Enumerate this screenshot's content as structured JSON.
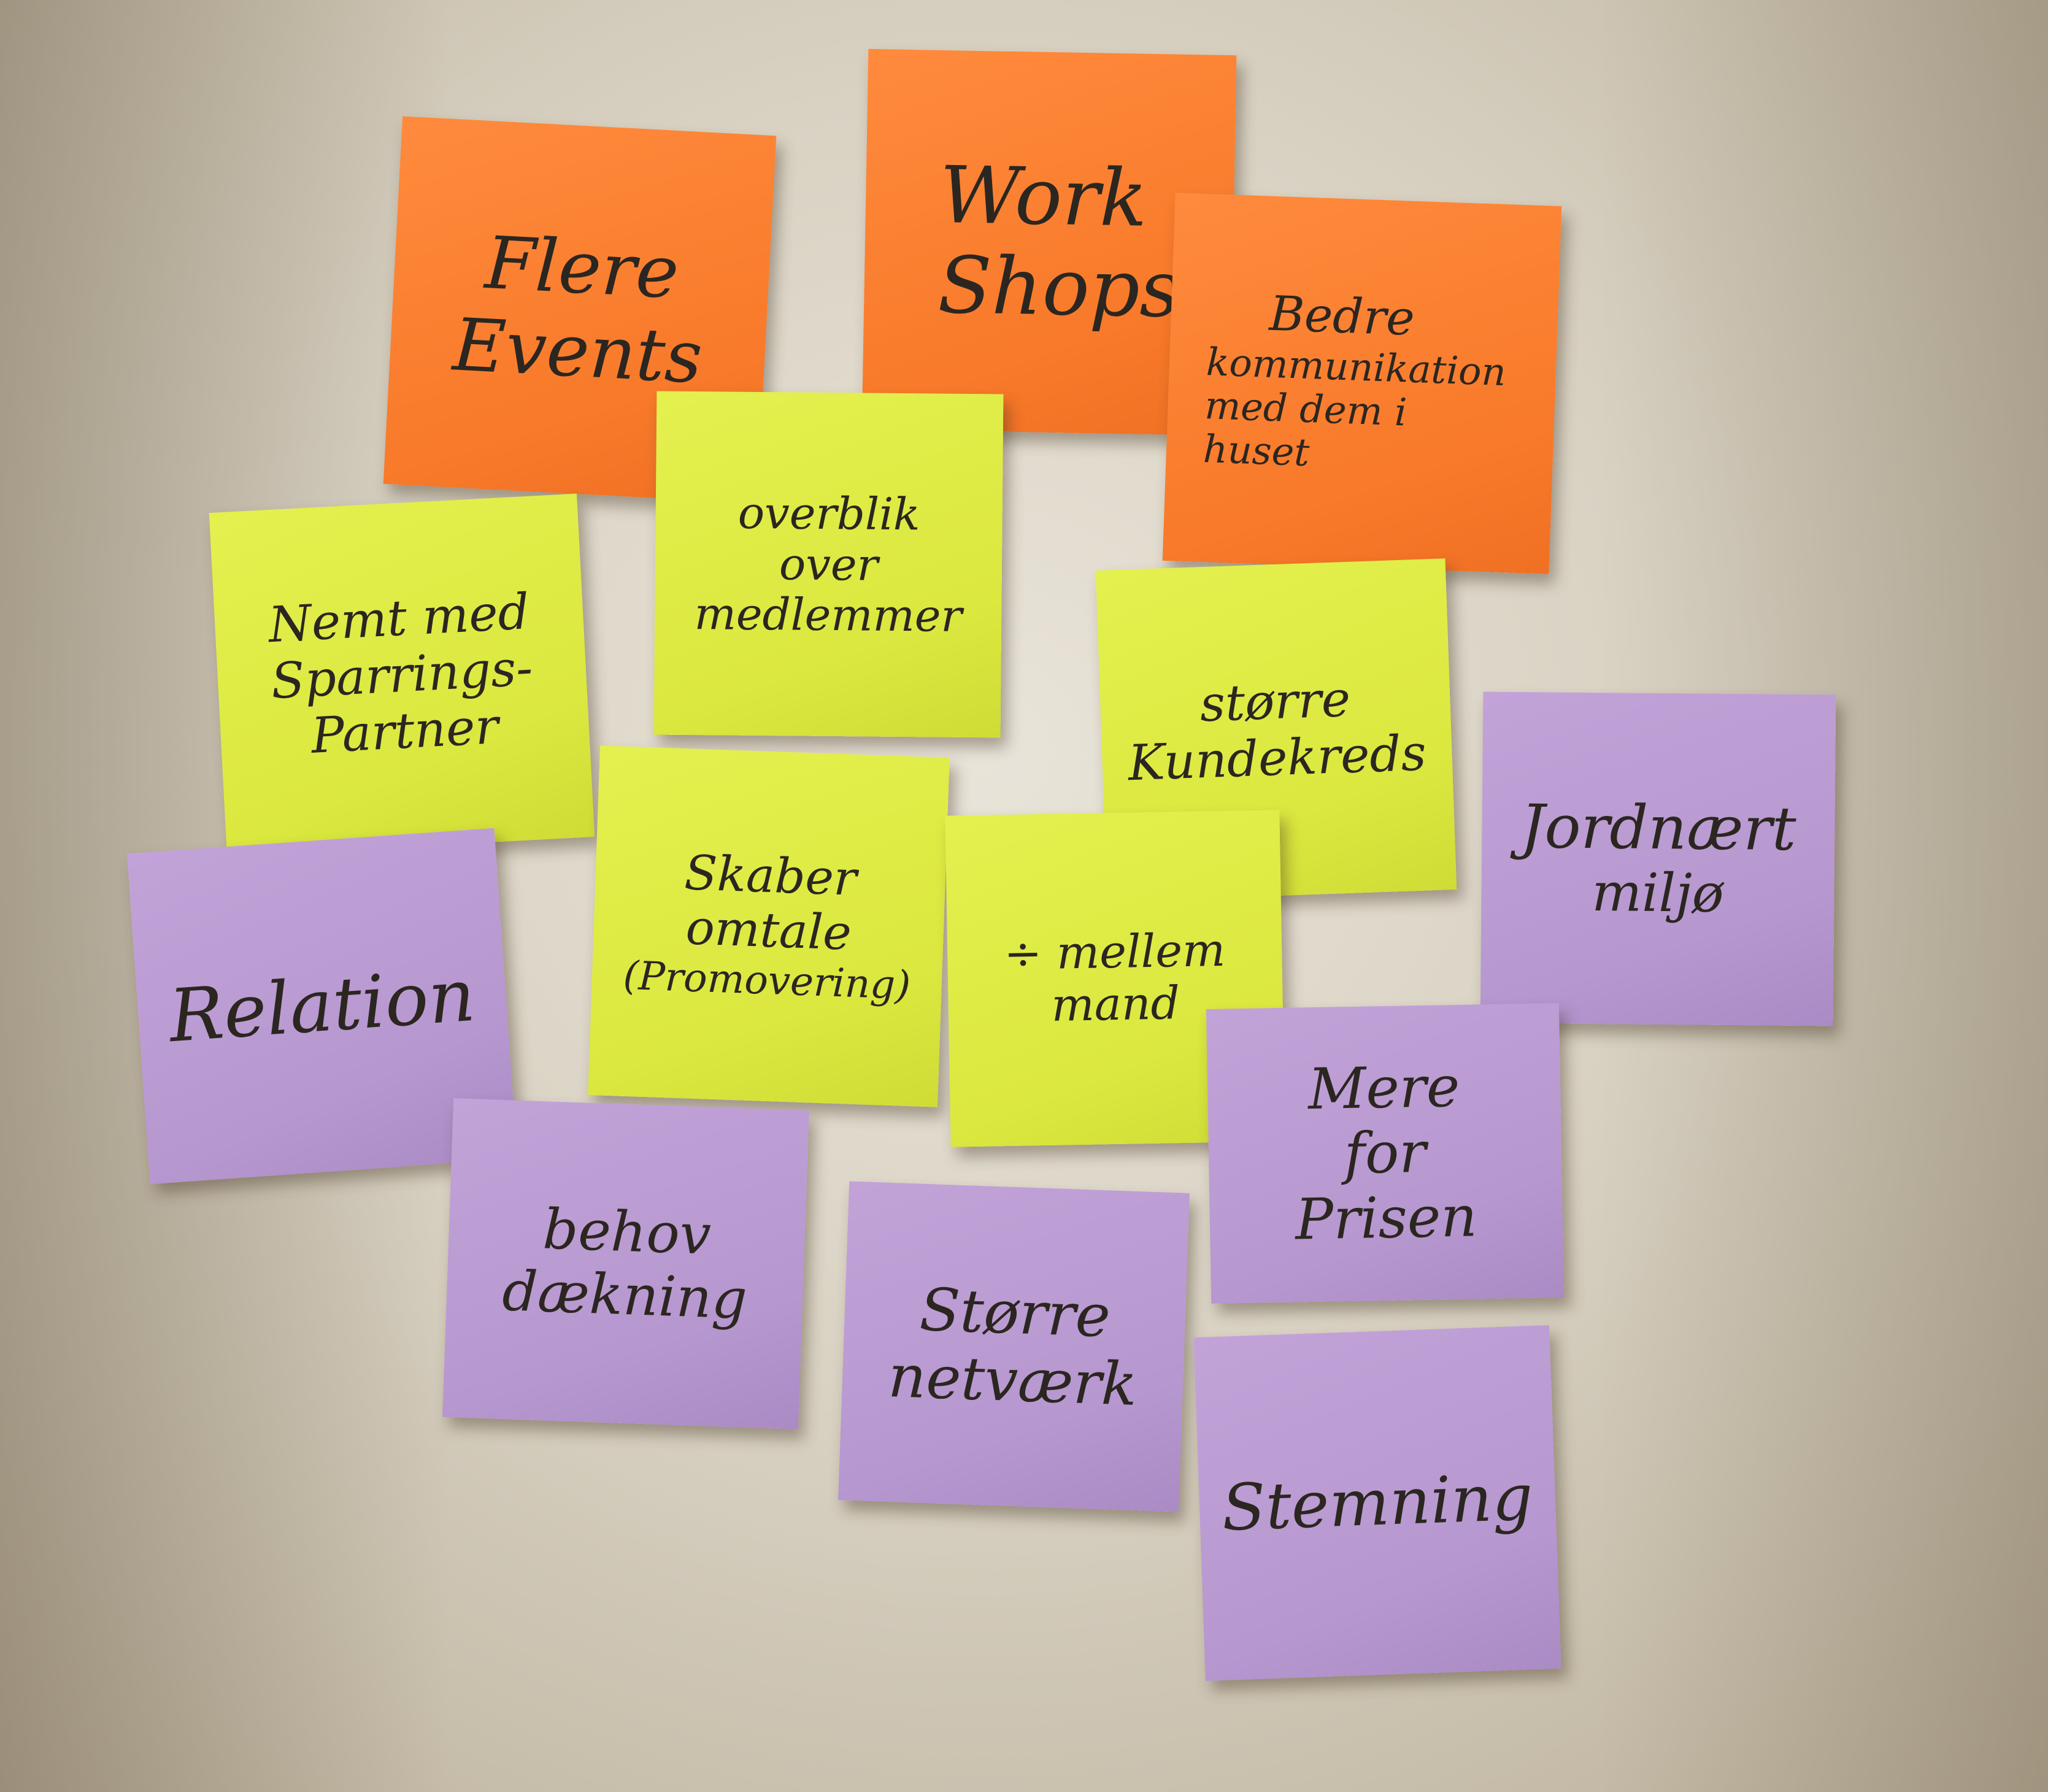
{
  "notes": {
    "flere_events": {
      "color": "#f87a2a",
      "lines": [
        "Flere",
        "Events"
      ]
    },
    "workshops": {
      "color": "#f87a2a",
      "lines": [
        "Work",
        "Shops"
      ]
    },
    "bedre": {
      "color": "#f87a2a",
      "lines": [
        "Bedre",
        "kommunikation",
        "med dem i",
        "huset"
      ]
    },
    "overblik": {
      "color": "#dbe83f",
      "lines": [
        "overblik",
        "over",
        "medlemmer"
      ]
    },
    "nemt": {
      "color": "#dbe83f",
      "lines": [
        "Nemt med",
        "Sparrings-",
        "Partner"
      ]
    },
    "stoerre_kunde": {
      "color": "#dbe83f",
      "lines": [
        "større",
        "Kundekreds"
      ]
    },
    "skaber": {
      "color": "#dbe83f",
      "lines": [
        "Skaber",
        "omtale",
        "(Promovering)"
      ]
    },
    "mellemmand": {
      "color": "#dbe83f",
      "lines": [
        "÷ mellem",
        "mand"
      ]
    },
    "jordnaert": {
      "color": "#b697cf",
      "lines": [
        "Jordnært",
        "miljø"
      ]
    },
    "relation": {
      "color": "#b697cf",
      "lines": [
        "Relation"
      ]
    },
    "behov": {
      "color": "#b697cf",
      "lines": [
        "behov",
        "dækning"
      ]
    },
    "mere": {
      "color": "#b697cf",
      "lines": [
        "Mere",
        "for",
        "Prisen"
      ]
    },
    "stoerre_netv": {
      "color": "#b697cf",
      "lines": [
        "Større",
        "netværk"
      ]
    },
    "stemning": {
      "color": "#b697cf",
      "lines": [
        "Stemning"
      ]
    }
  }
}
